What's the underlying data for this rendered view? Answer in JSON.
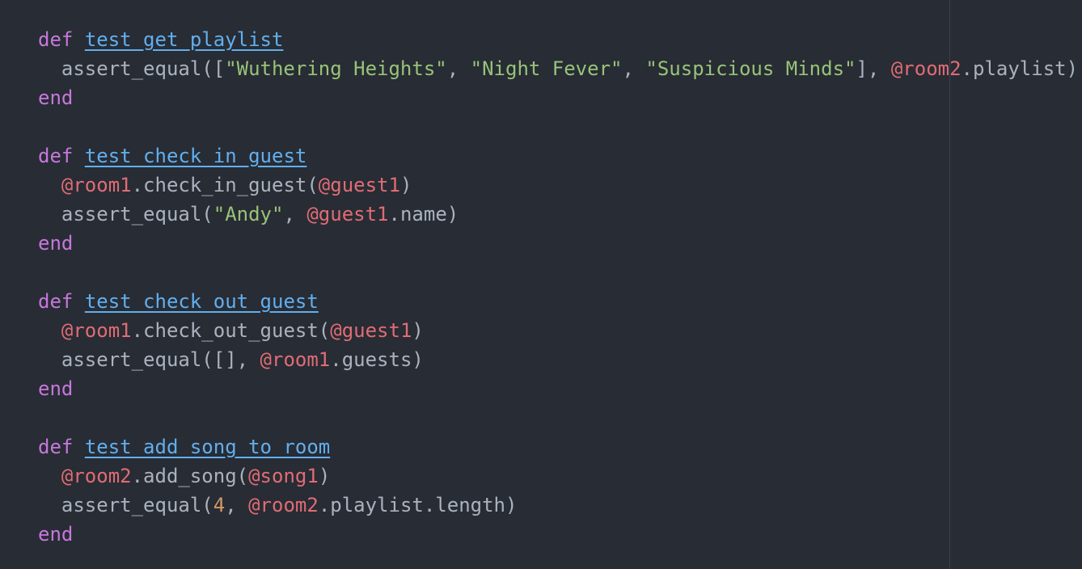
{
  "editor": {
    "theme_colors": {
      "background": "#282c34",
      "keyword": "#c678dd",
      "function": "#61afef",
      "string": "#98c379",
      "instance_variable": "#e06c75",
      "number": "#d19a66",
      "plain": "#abb2bf"
    },
    "lines": [
      [
        {
          "t": "kw",
          "v": "def"
        },
        {
          "t": "pl",
          "v": " "
        },
        {
          "t": "fn",
          "v": "test_get_playlist"
        }
      ],
      [
        {
          "t": "pl",
          "v": "  assert_equal(["
        },
        {
          "t": "str",
          "v": "\"Wuthering Heights\""
        },
        {
          "t": "pl",
          "v": ", "
        },
        {
          "t": "str",
          "v": "\"Night Fever\""
        },
        {
          "t": "pl",
          "v": ", "
        },
        {
          "t": "str",
          "v": "\"Suspicious Minds\""
        },
        {
          "t": "pl",
          "v": "], "
        },
        {
          "t": "ivar",
          "v": "@room2"
        },
        {
          "t": "pl",
          "v": ".playlist)"
        }
      ],
      [
        {
          "t": "kw",
          "v": "end"
        }
      ],
      [],
      [
        {
          "t": "kw",
          "v": "def"
        },
        {
          "t": "pl",
          "v": " "
        },
        {
          "t": "fn",
          "v": "test_check_in_guest"
        }
      ],
      [
        {
          "t": "pl",
          "v": "  "
        },
        {
          "t": "ivar",
          "v": "@room1"
        },
        {
          "t": "pl",
          "v": ".check_in_guest("
        },
        {
          "t": "ivar",
          "v": "@guest1"
        },
        {
          "t": "pl",
          "v": ")"
        }
      ],
      [
        {
          "t": "pl",
          "v": "  assert_equal("
        },
        {
          "t": "str",
          "v": "\"Andy\""
        },
        {
          "t": "pl",
          "v": ", "
        },
        {
          "t": "ivar",
          "v": "@guest1"
        },
        {
          "t": "pl",
          "v": ".name)"
        }
      ],
      [
        {
          "t": "kw",
          "v": "end"
        }
      ],
      [],
      [
        {
          "t": "kw",
          "v": "def"
        },
        {
          "t": "pl",
          "v": " "
        },
        {
          "t": "fn",
          "v": "test_check_out_guest"
        }
      ],
      [
        {
          "t": "pl",
          "v": "  "
        },
        {
          "t": "ivar",
          "v": "@room1"
        },
        {
          "t": "pl",
          "v": ".check_out_guest("
        },
        {
          "t": "ivar",
          "v": "@guest1"
        },
        {
          "t": "pl",
          "v": ")"
        }
      ],
      [
        {
          "t": "pl",
          "v": "  assert_equal([], "
        },
        {
          "t": "ivar",
          "v": "@room1"
        },
        {
          "t": "pl",
          "v": ".guests)"
        }
      ],
      [
        {
          "t": "kw",
          "v": "end"
        }
      ],
      [],
      [
        {
          "t": "kw",
          "v": "def"
        },
        {
          "t": "pl",
          "v": " "
        },
        {
          "t": "fn",
          "v": "test_add_song_to_room"
        }
      ],
      [
        {
          "t": "pl",
          "v": "  "
        },
        {
          "t": "ivar",
          "v": "@room2"
        },
        {
          "t": "pl",
          "v": ".add_song("
        },
        {
          "t": "ivar",
          "v": "@song1"
        },
        {
          "t": "pl",
          "v": ")"
        }
      ],
      [
        {
          "t": "pl",
          "v": "  assert_equal("
        },
        {
          "t": "num",
          "v": "4"
        },
        {
          "t": "pl",
          "v": ", "
        },
        {
          "t": "ivar",
          "v": "@room2"
        },
        {
          "t": "pl",
          "v": ".playlist.length)"
        }
      ],
      [
        {
          "t": "kw",
          "v": "end"
        }
      ]
    ]
  }
}
